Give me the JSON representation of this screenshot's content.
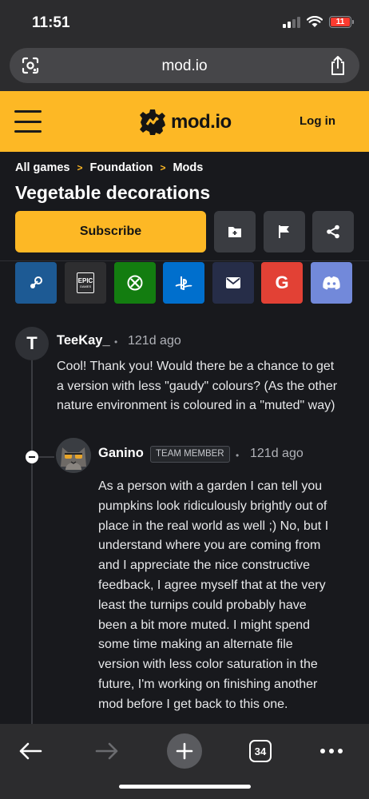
{
  "status": {
    "time": "11:51",
    "battery": "11"
  },
  "browser": {
    "url": "mod.io",
    "tab_count": "34"
  },
  "header": {
    "logo": "mod.io",
    "login": "Log in"
  },
  "breadcrumb": {
    "items": [
      "All games",
      "Foundation",
      "Mods"
    ],
    "separator": ">"
  },
  "page": {
    "title": "Vegetable decorations",
    "subscribe": "Subscribe"
  },
  "social": {
    "epic_label": "EPIC",
    "epic_sub": "GAMES",
    "google_label": "G",
    "colors": {
      "steam": "#1d5a94",
      "epic": "#2e2e30",
      "xbox": "#137d10",
      "playstation": "#006fcd",
      "email": "#262d48",
      "google": "#e24135",
      "discord": "#7289da"
    }
  },
  "comments": [
    {
      "author": "TeeKay_",
      "initial": "T",
      "dot": "•",
      "time": "121d ago",
      "lines": [
        "Cool! Thank you! Would there be a chance to get",
        "a version with less \"gaudy\" colours? (As the other",
        "nature environment is coloured in a \"muted\" way)"
      ]
    },
    {
      "author": "Ganino",
      "badge": "TEAM MEMBER",
      "dot": "•",
      "time": "121d ago",
      "lines": [
        "As a person with a garden I can tell you",
        "pumpkins look ridiculously brightly out of",
        "place in the real world as well ;) No, but I",
        "understand where you are coming from",
        "and I appreciate the nice constructive",
        "feedback, I agree myself that at the very",
        "least the turnips could probably have",
        "been a bit more muted. I might spend",
        "some time making an alternate file",
        "version with less color saturation in the",
        "future, I'm working on finishing another",
        "mod before I get back to this one."
      ]
    }
  ],
  "theme": {
    "accent": "#fdb825",
    "background": "#18191d",
    "button_dark": "#3a3c41"
  }
}
